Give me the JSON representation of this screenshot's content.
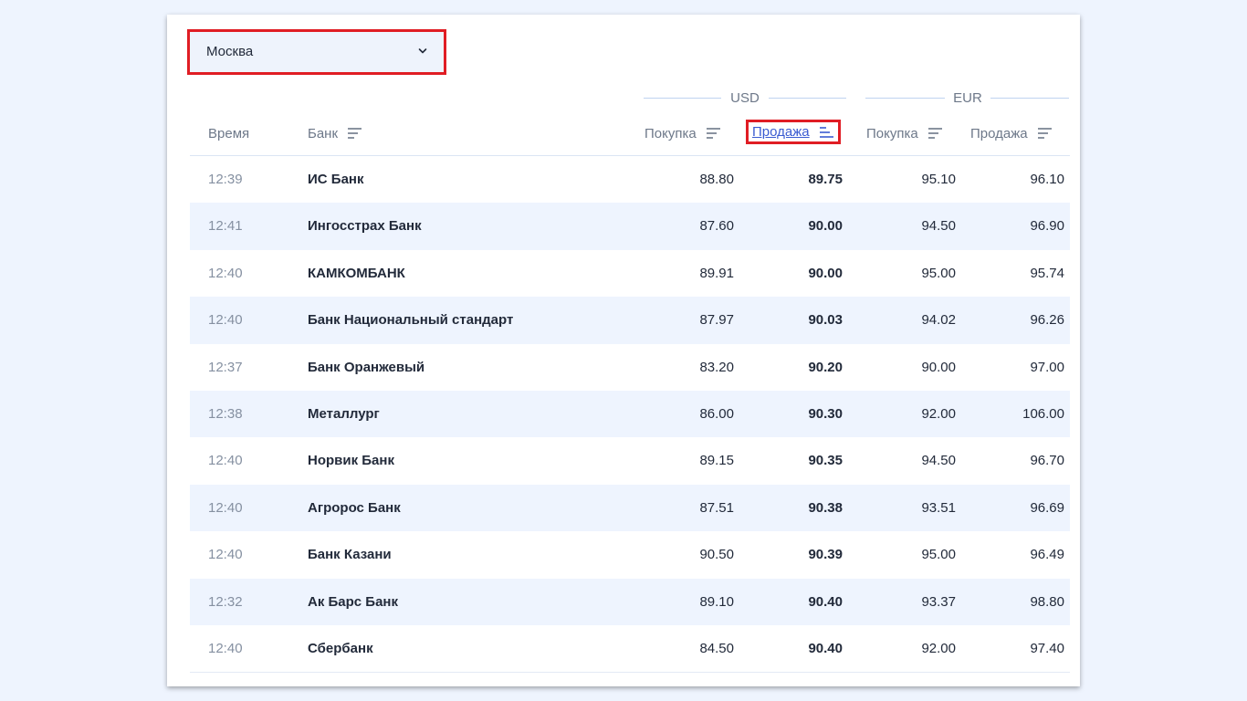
{
  "city_select": {
    "value": "Москва"
  },
  "groups": [
    {
      "label": "USD"
    },
    {
      "label": "EUR"
    }
  ],
  "columns": {
    "time": "Время",
    "bank": "Банк",
    "usd_buy": "Покупка",
    "usd_sell": "Продажа",
    "eur_buy": "Покупка",
    "eur_sell": "Продажа"
  },
  "active_sort": "usd_sell",
  "colors": {
    "accent": "#3a5bd1",
    "highlight_border": "#e01d24",
    "row_alt": "#eef4fe"
  },
  "rows": [
    {
      "time": "12:39",
      "bank": "ИС Банк",
      "usd_buy": "88.80",
      "usd_sell": "89.75",
      "eur_buy": "95.10",
      "eur_sell": "96.10"
    },
    {
      "time": "12:41",
      "bank": "Ингосстрах Банк",
      "usd_buy": "87.60",
      "usd_sell": "90.00",
      "eur_buy": "94.50",
      "eur_sell": "96.90"
    },
    {
      "time": "12:40",
      "bank": "КАМКОМБАНК",
      "usd_buy": "89.91",
      "usd_sell": "90.00",
      "eur_buy": "95.00",
      "eur_sell": "95.74"
    },
    {
      "time": "12:40",
      "bank": "Банк Национальный стандарт",
      "usd_buy": "87.97",
      "usd_sell": "90.03",
      "eur_buy": "94.02",
      "eur_sell": "96.26"
    },
    {
      "time": "12:37",
      "bank": "Банк Оранжевый",
      "usd_buy": "83.20",
      "usd_sell": "90.20",
      "eur_buy": "90.00",
      "eur_sell": "97.00"
    },
    {
      "time": "12:38",
      "bank": "Металлург",
      "usd_buy": "86.00",
      "usd_sell": "90.30",
      "eur_buy": "92.00",
      "eur_sell": "106.00"
    },
    {
      "time": "12:40",
      "bank": "Норвик Банк",
      "usd_buy": "89.15",
      "usd_sell": "90.35",
      "eur_buy": "94.50",
      "eur_sell": "96.70"
    },
    {
      "time": "12:40",
      "bank": "Агророс Банк",
      "usd_buy": "87.51",
      "usd_sell": "90.38",
      "eur_buy": "93.51",
      "eur_sell": "96.69"
    },
    {
      "time": "12:40",
      "bank": "Банк Казани",
      "usd_buy": "90.50",
      "usd_sell": "90.39",
      "eur_buy": "95.00",
      "eur_sell": "96.49"
    },
    {
      "time": "12:32",
      "bank": "Ак Барс Банк",
      "usd_buy": "89.10",
      "usd_sell": "90.40",
      "eur_buy": "93.37",
      "eur_sell": "98.80"
    },
    {
      "time": "12:40",
      "bank": "Сбербанк",
      "usd_buy": "84.50",
      "usd_sell": "90.40",
      "eur_buy": "92.00",
      "eur_sell": "97.40"
    }
  ]
}
